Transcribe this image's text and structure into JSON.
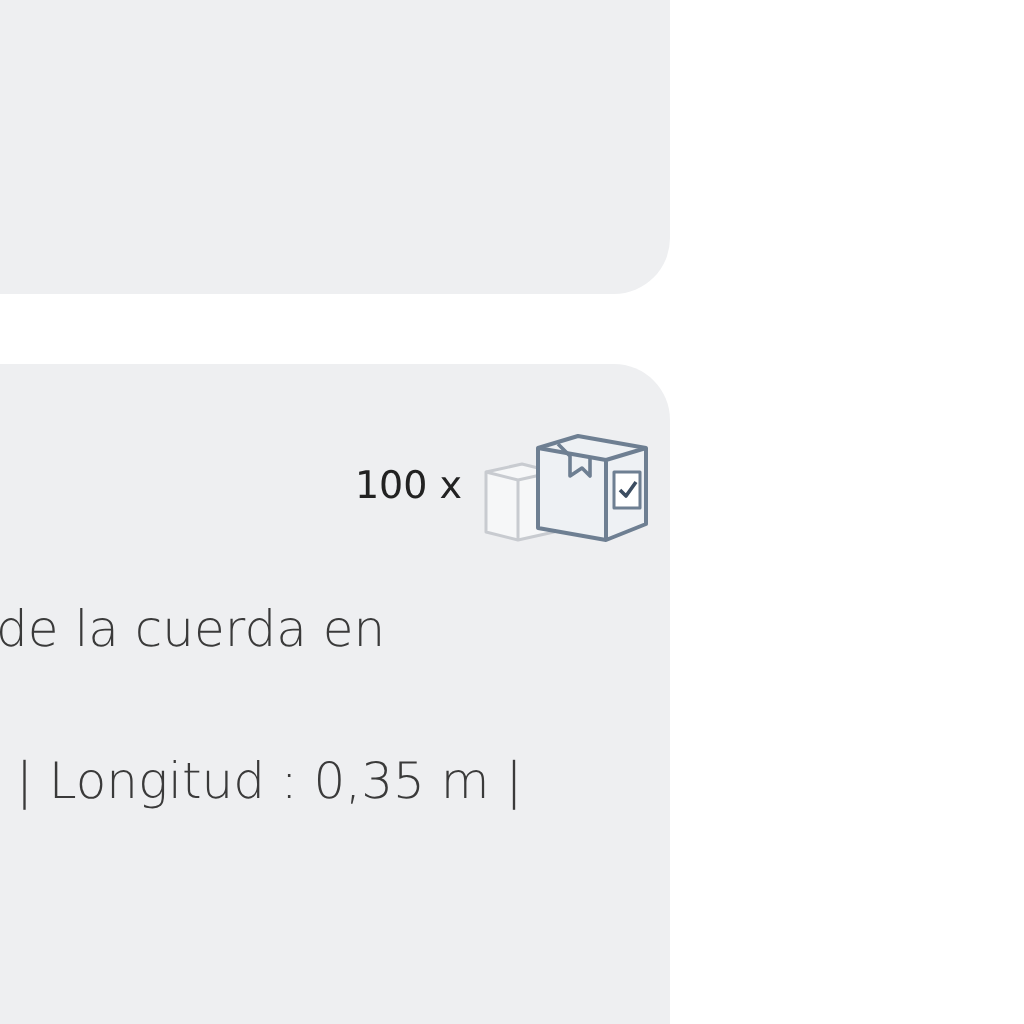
{
  "product_card": {
    "quantity": "100 x",
    "description_line": "de la cuerda en",
    "specs_line": "| Longitud : 0,35 m |"
  }
}
